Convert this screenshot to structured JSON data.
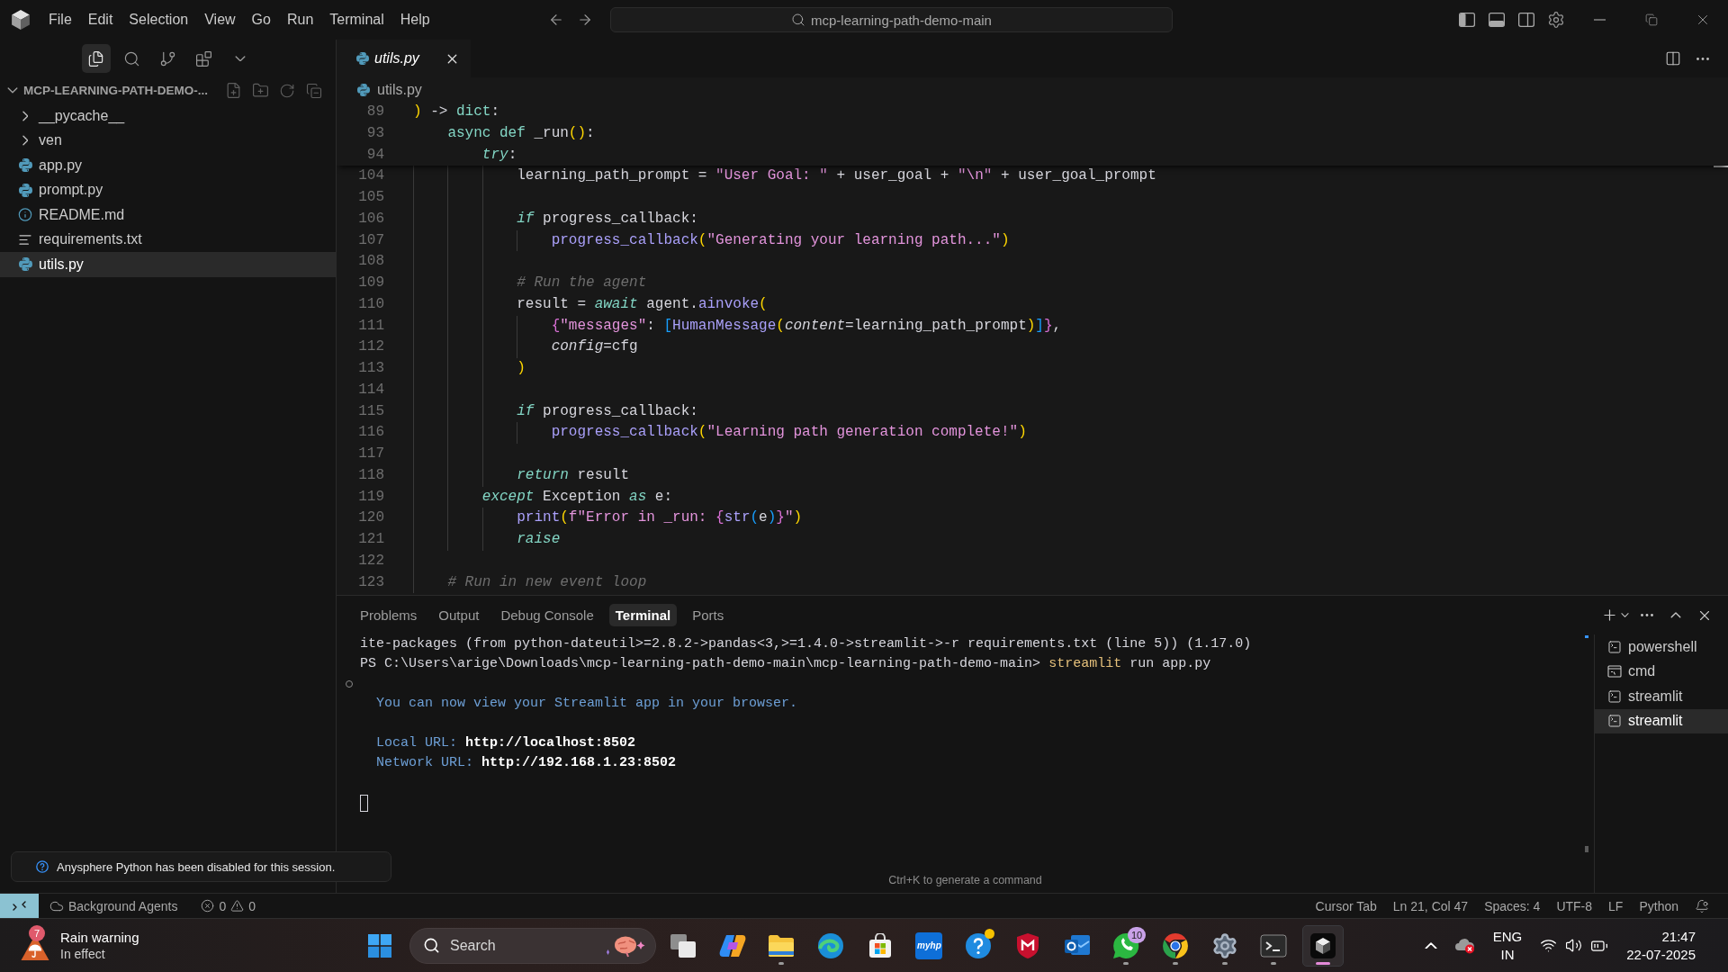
{
  "title_bar": {
    "menu": [
      "File",
      "Edit",
      "Selection",
      "View",
      "Go",
      "Run",
      "Terminal",
      "Help"
    ],
    "command_center": "mcp-learning-path-demo-main",
    "layout_toggles": [
      {
        "kind": "sidebar",
        "on": true
      },
      {
        "kind": "panel",
        "on": true
      },
      {
        "kind": "secondary-sidebar",
        "on": false
      }
    ]
  },
  "sidebar": {
    "views": [
      {
        "kind": "files",
        "selected": true
      },
      {
        "kind": "search",
        "selected": false
      },
      {
        "kind": "source-control",
        "selected": false
      },
      {
        "kind": "extensions",
        "selected": false
      }
    ],
    "title": "MCP-LEARNING-PATH-DEMO-...",
    "expanded": true,
    "items": [
      {
        "label": "__pycache__",
        "kind": "folder",
        "expanded": false,
        "selected": false
      },
      {
        "label": "ven",
        "kind": "folder",
        "expanded": false,
        "selected": false
      },
      {
        "label": "app.py",
        "kind": "python",
        "selected": false
      },
      {
        "label": "prompt.py",
        "kind": "python",
        "selected": false
      },
      {
        "label": "README.md",
        "kind": "info",
        "selected": false
      },
      {
        "label": "requirements.txt",
        "kind": "text",
        "selected": false
      },
      {
        "label": "utils.py",
        "kind": "python",
        "selected": true
      }
    ]
  },
  "notification": {
    "message": "Anysphere Python has been disabled for this session."
  },
  "editor": {
    "tabs": [
      {
        "label": "utils.py",
        "kind": "python",
        "selected": true,
        "preview": true
      }
    ],
    "breadcrumb": [
      {
        "label": "utils.py",
        "kind": "python"
      }
    ],
    "sticky_lines": [
      {
        "number": "89",
        "tokens": [
          {
            "text": ")",
            "kind": "bracket-1"
          },
          {
            "text": " -> ",
            "kind": "plain"
          },
          {
            "text": "dict",
            "kind": "keyword"
          },
          {
            "text": ":",
            "kind": "plain"
          }
        ]
      },
      {
        "number": "93",
        "tokens": [
          {
            "text": "    async def",
            "kind": "keyword"
          },
          {
            "text": " _run",
            "kind": "plain"
          },
          {
            "text": "()",
            "kind": "bracket-1"
          },
          {
            "text": ":",
            "kind": "plain"
          }
        ]
      },
      {
        "number": "94",
        "tokens": [
          {
            "text": "        try",
            "kind": "control"
          },
          {
            "text": ":",
            "kind": "plain"
          }
        ]
      }
    ],
    "lines": [
      {
        "number": "104",
        "tokens": [
          {
            "text": "            learning_path_prompt = ",
            "kind": "plain"
          },
          {
            "text": "\"User Goal: \"",
            "kind": "string"
          },
          {
            "text": " + user_goal + ",
            "kind": "plain"
          },
          {
            "text": "\"\\n\"",
            "kind": "string"
          },
          {
            "text": " + user_goal_prompt",
            "kind": "plain"
          }
        ]
      },
      {
        "number": "105"
      },
      {
        "number": "106",
        "tokens": [
          {
            "text": "            if",
            "kind": "control"
          },
          {
            "text": " progress_callback:",
            "kind": "plain"
          }
        ]
      },
      {
        "number": "107",
        "tokens": [
          {
            "text": "                progress_callback",
            "kind": "function"
          },
          {
            "text": "(",
            "kind": "bracket-1"
          },
          {
            "text": "\"Generating your learning path...\"",
            "kind": "string"
          },
          {
            "text": ")",
            "kind": "bracket-1"
          }
        ]
      },
      {
        "number": "108"
      },
      {
        "number": "109",
        "tokens": [
          {
            "text": "            # Run the agent",
            "kind": "comment"
          }
        ]
      },
      {
        "number": "110",
        "tokens": [
          {
            "text": "            result = ",
            "kind": "plain"
          },
          {
            "text": "await",
            "kind": "control"
          },
          {
            "text": " agent.",
            "kind": "plain"
          },
          {
            "text": "ainvoke",
            "kind": "function"
          },
          {
            "text": "(",
            "kind": "bracket-1"
          }
        ]
      },
      {
        "number": "111",
        "tokens": [
          {
            "text": "                {",
            "kind": "bracket-2"
          },
          {
            "text": "\"messages\"",
            "kind": "string"
          },
          {
            "text": ": ",
            "kind": "plain"
          },
          {
            "text": "[",
            "kind": "bracket-3"
          },
          {
            "text": "HumanMessage",
            "kind": "function"
          },
          {
            "text": "(",
            "kind": "bracket-1"
          },
          {
            "text": "content",
            "kind": "param"
          },
          {
            "text": "=learning_path_prompt",
            "kind": "plain"
          },
          {
            "text": ")",
            "kind": "bracket-1"
          },
          {
            "text": "]",
            "kind": "bracket-3"
          },
          {
            "text": "}",
            "kind": "bracket-2"
          },
          {
            "text": ",",
            "kind": "plain"
          }
        ]
      },
      {
        "number": "112",
        "tokens": [
          {
            "text": "                config",
            "kind": "param"
          },
          {
            "text": "=cfg",
            "kind": "plain"
          }
        ]
      },
      {
        "number": "113",
        "tokens": [
          {
            "text": "            )",
            "kind": "bracket-1"
          }
        ]
      },
      {
        "number": "114"
      },
      {
        "number": "115",
        "tokens": [
          {
            "text": "            if",
            "kind": "control"
          },
          {
            "text": " progress_callback:",
            "kind": "plain"
          }
        ]
      },
      {
        "number": "116",
        "tokens": [
          {
            "text": "                progress_callback",
            "kind": "function"
          },
          {
            "text": "(",
            "kind": "bracket-1"
          },
          {
            "text": "\"Learning path generation complete!\"",
            "kind": "string"
          },
          {
            "text": ")",
            "kind": "bracket-1"
          }
        ]
      },
      {
        "number": "117"
      },
      {
        "number": "118",
        "tokens": [
          {
            "text": "            return",
            "kind": "control"
          },
          {
            "text": " result",
            "kind": "plain"
          }
        ]
      },
      {
        "number": "119",
        "tokens": [
          {
            "text": "        except",
            "kind": "control"
          },
          {
            "text": " Exception ",
            "kind": "plain"
          },
          {
            "text": "as",
            "kind": "control"
          },
          {
            "text": " e:",
            "kind": "plain"
          }
        ]
      },
      {
        "number": "120",
        "tokens": [
          {
            "text": "            print",
            "kind": "function"
          },
          {
            "text": "(",
            "kind": "bracket-1"
          },
          {
            "text": "f\"Error in _run: ",
            "kind": "string"
          },
          {
            "text": "{",
            "kind": "bracket-2"
          },
          {
            "text": "str",
            "kind": "function"
          },
          {
            "text": "(",
            "kind": "bracket-3"
          },
          {
            "text": "e",
            "kind": "plain"
          },
          {
            "text": ")",
            "kind": "bracket-3"
          },
          {
            "text": "}",
            "kind": "bracket-2"
          },
          {
            "text": "\"",
            "kind": "string"
          },
          {
            "text": ")",
            "kind": "bracket-1"
          }
        ]
      },
      {
        "number": "121",
        "tokens": [
          {
            "text": "            raise",
            "kind": "control"
          }
        ]
      },
      {
        "number": "122"
      },
      {
        "number": "123",
        "tokens": [
          {
            "text": "    # Run in new event loop",
            "kind": "comment"
          }
        ]
      }
    ]
  },
  "panel": {
    "tabs": [
      {
        "label": "Problems",
        "selected": false
      },
      {
        "label": "Output",
        "selected": false
      },
      {
        "label": "Debug Console",
        "selected": false
      },
      {
        "label": "Terminal",
        "selected": true
      },
      {
        "label": "Ports",
        "selected": false
      }
    ],
    "terminal": {
      "paragraphs": [
        {
          "command_running": true,
          "lines": [
            [
              {
                "text": "ite-packages (from python-dateutil>=2.8.2->pandas<3,>=1.4.0->streamlit->-r requirements.txt (line 5)) (1.17.0)",
                "kind": "plain"
              }
            ],
            [
              {
                "text": "PS C:\\Users\\arige\\Downloads\\mcp-learning-path-demo-main\\mcp-learning-path-demo-main> ",
                "kind": "plain"
              },
              {
                "text": "streamlit",
                "kind": "command"
              },
              {
                "text": " run app.py",
                "kind": "plain"
              }
            ]
          ]
        },
        {
          "command_running": false,
          "lines": [
            [
              {
                "text": "  You can now view your Streamlit app in your browser.",
                "kind": "info"
              }
            ]
          ]
        },
        {
          "command_running": false,
          "lines": [
            [
              {
                "text": "  Local URL: ",
                "kind": "info"
              },
              {
                "text": "http://localhost:8502",
                "kind": "link"
              }
            ],
            [
              {
                "text": "  Network URL: ",
                "kind": "info"
              },
              {
                "text": "http://192.168.1.23:8502",
                "kind": "link"
              }
            ]
          ]
        }
      ],
      "cursor_focused": false,
      "hint": "Ctrl+K to generate a command",
      "sessions": [
        {
          "label": "powershell",
          "kind": "shell",
          "selected": false
        },
        {
          "label": "cmd",
          "kind": "cmd",
          "selected": false
        },
        {
          "label": "streamlit",
          "kind": "shell",
          "selected": false
        },
        {
          "label": "streamlit",
          "kind": "shell",
          "selected": true
        }
      ]
    }
  },
  "status_bar": {
    "agents": "Background Agents",
    "errors": "0",
    "warnings": "0",
    "items": [
      "Cursor Tab",
      "Ln 21, Col 47",
      "Spaces: 4",
      "UTF-8",
      "LF",
      "Python"
    ]
  },
  "taskbar": {
    "weather": {
      "title": "Rain warning",
      "subtitle": "In effect",
      "badge": "7"
    },
    "search": {
      "placeholder": "Search"
    },
    "apps": [
      {
        "kind": "task-view",
        "running": false,
        "selected": false,
        "alert": false
      },
      {
        "kind": "assistant",
        "running": false,
        "selected": false,
        "alert": false
      },
      {
        "kind": "file-manager",
        "running": true,
        "selected": false,
        "alert": false
      },
      {
        "kind": "wave-browser",
        "running": false,
        "selected": false,
        "alert": false
      },
      {
        "kind": "store",
        "running": false,
        "selected": false,
        "alert": false
      },
      {
        "kind": "tile",
        "label": "myhp",
        "running": false,
        "selected": false,
        "alert": false
      },
      {
        "kind": "help",
        "running": false,
        "selected": false,
        "alert": true
      },
      {
        "kind": "shield",
        "running": false,
        "selected": false,
        "alert": false
      },
      {
        "kind": "mail",
        "running": false,
        "selected": false,
        "alert": false
      },
      {
        "kind": "chat",
        "badge": "10",
        "running": true,
        "selected": false,
        "alert": false
      },
      {
        "kind": "wheel-browser",
        "running": true,
        "selected": false,
        "alert": false
      },
      {
        "kind": "settings",
        "running": true,
        "selected": false,
        "alert": false
      },
      {
        "kind": "terminal",
        "running": true,
        "selected": false,
        "alert": false
      },
      {
        "kind": "editor",
        "running": true,
        "selected": true,
        "alert": false
      }
    ],
    "tray": {
      "language": "ENG",
      "region": "IN",
      "time": "21:47",
      "date": "22-07-2025"
    }
  }
}
